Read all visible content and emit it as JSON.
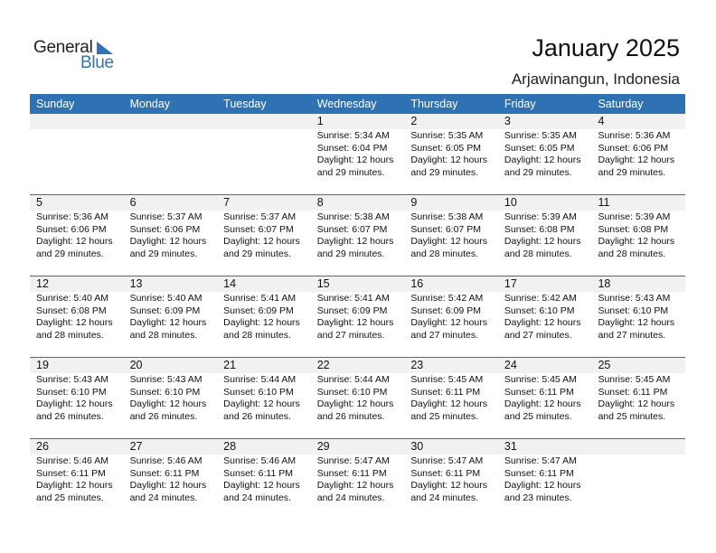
{
  "logo": {
    "line1": "General",
    "line2": "Blue",
    "icon": "triangle-flag-icon",
    "color": "#2f73b6"
  },
  "header": {
    "title": "January 2025",
    "location": "Arjawinangun, Indonesia"
  },
  "weekdays": [
    "Sunday",
    "Monday",
    "Tuesday",
    "Wednesday",
    "Thursday",
    "Friday",
    "Saturday"
  ],
  "colors": {
    "header_bg": "#2e72b3",
    "daynum_bg": "#f1f1f1"
  },
  "weeks": [
    [
      null,
      null,
      null,
      {
        "day": "1",
        "sunrise": "Sunrise: 5:34 AM",
        "sunset": "Sunset: 6:04 PM",
        "daylight1": "Daylight: 12 hours",
        "daylight2": "and 29 minutes."
      },
      {
        "day": "2",
        "sunrise": "Sunrise: 5:35 AM",
        "sunset": "Sunset: 6:05 PM",
        "daylight1": "Daylight: 12 hours",
        "daylight2": "and 29 minutes."
      },
      {
        "day": "3",
        "sunrise": "Sunrise: 5:35 AM",
        "sunset": "Sunset: 6:05 PM",
        "daylight1": "Daylight: 12 hours",
        "daylight2": "and 29 minutes."
      },
      {
        "day": "4",
        "sunrise": "Sunrise: 5:36 AM",
        "sunset": "Sunset: 6:06 PM",
        "daylight1": "Daylight: 12 hours",
        "daylight2": "and 29 minutes."
      }
    ],
    [
      {
        "day": "5",
        "sunrise": "Sunrise: 5:36 AM",
        "sunset": "Sunset: 6:06 PM",
        "daylight1": "Daylight: 12 hours",
        "daylight2": "and 29 minutes."
      },
      {
        "day": "6",
        "sunrise": "Sunrise: 5:37 AM",
        "sunset": "Sunset: 6:06 PM",
        "daylight1": "Daylight: 12 hours",
        "daylight2": "and 29 minutes."
      },
      {
        "day": "7",
        "sunrise": "Sunrise: 5:37 AM",
        "sunset": "Sunset: 6:07 PM",
        "daylight1": "Daylight: 12 hours",
        "daylight2": "and 29 minutes."
      },
      {
        "day": "8",
        "sunrise": "Sunrise: 5:38 AM",
        "sunset": "Sunset: 6:07 PM",
        "daylight1": "Daylight: 12 hours",
        "daylight2": "and 29 minutes."
      },
      {
        "day": "9",
        "sunrise": "Sunrise: 5:38 AM",
        "sunset": "Sunset: 6:07 PM",
        "daylight1": "Daylight: 12 hours",
        "daylight2": "and 28 minutes."
      },
      {
        "day": "10",
        "sunrise": "Sunrise: 5:39 AM",
        "sunset": "Sunset: 6:08 PM",
        "daylight1": "Daylight: 12 hours",
        "daylight2": "and 28 minutes."
      },
      {
        "day": "11",
        "sunrise": "Sunrise: 5:39 AM",
        "sunset": "Sunset: 6:08 PM",
        "daylight1": "Daylight: 12 hours",
        "daylight2": "and 28 minutes."
      }
    ],
    [
      {
        "day": "12",
        "sunrise": "Sunrise: 5:40 AM",
        "sunset": "Sunset: 6:08 PM",
        "daylight1": "Daylight: 12 hours",
        "daylight2": "and 28 minutes."
      },
      {
        "day": "13",
        "sunrise": "Sunrise: 5:40 AM",
        "sunset": "Sunset: 6:09 PM",
        "daylight1": "Daylight: 12 hours",
        "daylight2": "and 28 minutes."
      },
      {
        "day": "14",
        "sunrise": "Sunrise: 5:41 AM",
        "sunset": "Sunset: 6:09 PM",
        "daylight1": "Daylight: 12 hours",
        "daylight2": "and 28 minutes."
      },
      {
        "day": "15",
        "sunrise": "Sunrise: 5:41 AM",
        "sunset": "Sunset: 6:09 PM",
        "daylight1": "Daylight: 12 hours",
        "daylight2": "and 27 minutes."
      },
      {
        "day": "16",
        "sunrise": "Sunrise: 5:42 AM",
        "sunset": "Sunset: 6:09 PM",
        "daylight1": "Daylight: 12 hours",
        "daylight2": "and 27 minutes."
      },
      {
        "day": "17",
        "sunrise": "Sunrise: 5:42 AM",
        "sunset": "Sunset: 6:10 PM",
        "daylight1": "Daylight: 12 hours",
        "daylight2": "and 27 minutes."
      },
      {
        "day": "18",
        "sunrise": "Sunrise: 5:43 AM",
        "sunset": "Sunset: 6:10 PM",
        "daylight1": "Daylight: 12 hours",
        "daylight2": "and 27 minutes."
      }
    ],
    [
      {
        "day": "19",
        "sunrise": "Sunrise: 5:43 AM",
        "sunset": "Sunset: 6:10 PM",
        "daylight1": "Daylight: 12 hours",
        "daylight2": "and 26 minutes."
      },
      {
        "day": "20",
        "sunrise": "Sunrise: 5:43 AM",
        "sunset": "Sunset: 6:10 PM",
        "daylight1": "Daylight: 12 hours",
        "daylight2": "and 26 minutes."
      },
      {
        "day": "21",
        "sunrise": "Sunrise: 5:44 AM",
        "sunset": "Sunset: 6:10 PM",
        "daylight1": "Daylight: 12 hours",
        "daylight2": "and 26 minutes."
      },
      {
        "day": "22",
        "sunrise": "Sunrise: 5:44 AM",
        "sunset": "Sunset: 6:10 PM",
        "daylight1": "Daylight: 12 hours",
        "daylight2": "and 26 minutes."
      },
      {
        "day": "23",
        "sunrise": "Sunrise: 5:45 AM",
        "sunset": "Sunset: 6:11 PM",
        "daylight1": "Daylight: 12 hours",
        "daylight2": "and 25 minutes."
      },
      {
        "day": "24",
        "sunrise": "Sunrise: 5:45 AM",
        "sunset": "Sunset: 6:11 PM",
        "daylight1": "Daylight: 12 hours",
        "daylight2": "and 25 minutes."
      },
      {
        "day": "25",
        "sunrise": "Sunrise: 5:45 AM",
        "sunset": "Sunset: 6:11 PM",
        "daylight1": "Daylight: 12 hours",
        "daylight2": "and 25 minutes."
      }
    ],
    [
      {
        "day": "26",
        "sunrise": "Sunrise: 5:46 AM",
        "sunset": "Sunset: 6:11 PM",
        "daylight1": "Daylight: 12 hours",
        "daylight2": "and 25 minutes."
      },
      {
        "day": "27",
        "sunrise": "Sunrise: 5:46 AM",
        "sunset": "Sunset: 6:11 PM",
        "daylight1": "Daylight: 12 hours",
        "daylight2": "and 24 minutes."
      },
      {
        "day": "28",
        "sunrise": "Sunrise: 5:46 AM",
        "sunset": "Sunset: 6:11 PM",
        "daylight1": "Daylight: 12 hours",
        "daylight2": "and 24 minutes."
      },
      {
        "day": "29",
        "sunrise": "Sunrise: 5:47 AM",
        "sunset": "Sunset: 6:11 PM",
        "daylight1": "Daylight: 12 hours",
        "daylight2": "and 24 minutes."
      },
      {
        "day": "30",
        "sunrise": "Sunrise: 5:47 AM",
        "sunset": "Sunset: 6:11 PM",
        "daylight1": "Daylight: 12 hours",
        "daylight2": "and 24 minutes."
      },
      {
        "day": "31",
        "sunrise": "Sunrise: 5:47 AM",
        "sunset": "Sunset: 6:11 PM",
        "daylight1": "Daylight: 12 hours",
        "daylight2": "and 23 minutes."
      },
      null
    ]
  ]
}
